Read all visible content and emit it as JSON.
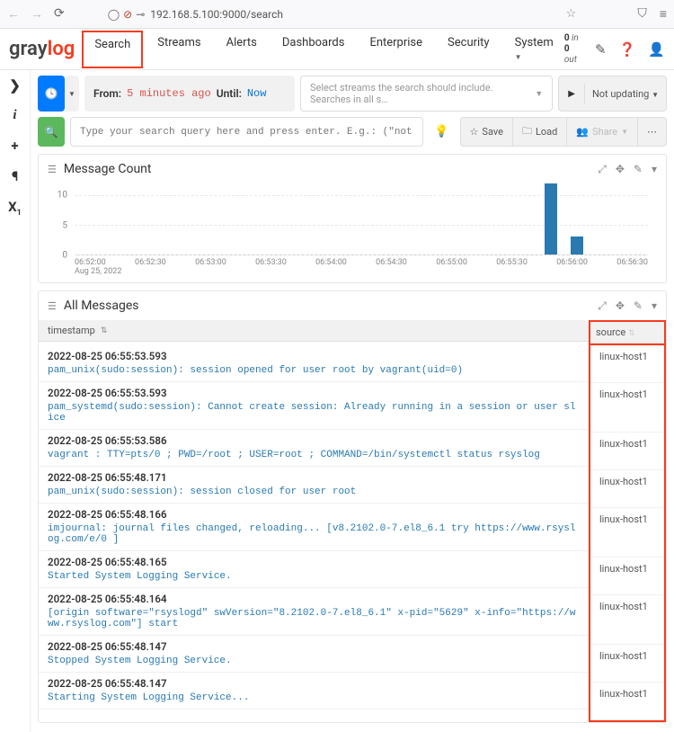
{
  "browser": {
    "url": "192.168.5.100:9000/search"
  },
  "nav": {
    "logo_left": "gray",
    "logo_right": "log",
    "tabs": [
      "Search",
      "Streams",
      "Alerts",
      "Dashboards",
      "Enterprise",
      "Security",
      "System"
    ],
    "stats_in_n": "0",
    "stats_in_l": "in",
    "stats_out_n": "0",
    "stats_out_l": "out"
  },
  "time": {
    "from_label": "From:",
    "from_val": "5 minutes ago",
    "until_label": "Until:",
    "until_val": "Now"
  },
  "stream_placeholder": "Select streams the search should include. Searches in all s…",
  "update_label": "Not updating",
  "query_placeholder": "Type your search query here and press enter. E.g.: (\"not found\" AND http) OR…",
  "actions": {
    "save": "Save",
    "load": "Load",
    "share": "Share"
  },
  "widget1_title": "Message Count",
  "widget2_title": "All Messages",
  "table": {
    "ts_col": "timestamp",
    "src_col": "source"
  },
  "x_date": "Aug 25, 2022",
  "chart_data": {
    "type": "bar",
    "ylim": [
      0,
      12
    ],
    "y_ticks": [
      0,
      5,
      10
    ],
    "x_ticks": [
      "06:52:00",
      "06:52:30",
      "06:53:00",
      "06:53:30",
      "06:54:00",
      "06:54:30",
      "06:55:00",
      "06:55:30",
      "06:56:00",
      "06:56:30"
    ],
    "bars": [
      {
        "x_pct": 82,
        "value": 12
      },
      {
        "x_pct": 86.5,
        "value": 3
      }
    ]
  },
  "logs": [
    {
      "ts": "2022-08-25 06:55:53.593",
      "msg": "pam_unix(sudo:session): session opened for user root by vagrant(uid=0)",
      "src": "linux-host1"
    },
    {
      "ts": "2022-08-25 06:55:53.593",
      "msg": "pam_systemd(sudo:session): Cannot create session: Already running in a session or user slice",
      "src": "linux-host1"
    },
    {
      "ts": "2022-08-25 06:55:53.586",
      "msg": "vagrant : TTY=pts/0 ; PWD=/root ; USER=root ; COMMAND=/bin/systemctl status rsyslog",
      "src": "linux-host1"
    },
    {
      "ts": "2022-08-25 06:55:48.171",
      "msg": "pam_unix(sudo:session): session closed for user root",
      "src": "linux-host1"
    },
    {
      "ts": "2022-08-25 06:55:48.166",
      "msg": "imjournal: journal files changed, reloading... [v8.2102.0-7.el8_6.1 try https://www.rsyslog.com/e/0 ]",
      "src": "linux-host1"
    },
    {
      "ts": "2022-08-25 06:55:48.165",
      "msg": "Started System Logging Service.",
      "src": "linux-host1"
    },
    {
      "ts": "2022-08-25 06:55:48.164",
      "msg": "[origin software=\"rsyslogd\" swVersion=\"8.2102.0-7.el8_6.1\" x-pid=\"5629\" x-info=\"https://www.rsyslog.com\"] start",
      "src": "linux-host1"
    },
    {
      "ts": "2022-08-25 06:55:48.147",
      "msg": "Stopped System Logging Service.",
      "src": "linux-host1"
    },
    {
      "ts": "2022-08-25 06:55:48.147",
      "msg": "Starting System Logging Service...",
      "src": "linux-host1"
    }
  ]
}
